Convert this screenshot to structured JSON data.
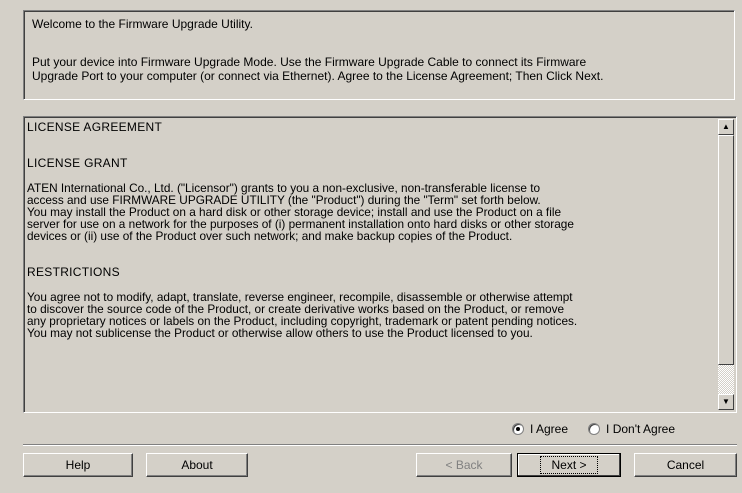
{
  "intro": {
    "welcome": "Welcome to the Firmware Upgrade Utility.",
    "instructions_line1": "Put your device into Firmware Upgrade Mode. Use the Firmware Upgrade Cable to connect its Firmware",
    "instructions_line2": "Upgrade Port to your computer (or connect via Ethernet). Agree to the License Agreement; Then Click Next."
  },
  "license": {
    "title": "LICENSE AGREEMENT",
    "grant_heading": "LICENSE GRANT",
    "grant_lines": [
      "ATEN International Co., Ltd. (\"Licensor\") grants to you a non-exclusive, non-transferable license to",
      "access and use FIRMWARE UPGRADE UTILITY (the \"Product\") during the \"Term\" set forth below.",
      "You may install the Product on a hard disk or other storage device; install and use the Product on a file",
      "server for use on a network for the purposes of (i) permanent installation onto hard disks or other storage",
      "devices or (ii) use of the Product over such network; and make backup copies of the Product."
    ],
    "restrictions_heading": "RESTRICTIONS",
    "restrictions_lines": [
      "You agree not to modify, adapt, translate, reverse engineer, recompile, disassemble or otherwise attempt",
      "to discover the source code of the Product, or create derivative works based on the Product, or remove",
      "any proprietary notices or labels on the Product, including copyright, trademark or patent pending notices.",
      "You may not sublicense the Product or otherwise allow others to use the Product licensed to you."
    ]
  },
  "agreement": {
    "agree_label": "I Agree",
    "disagree_label": "I Don't Agree",
    "selected": "agree"
  },
  "buttons": {
    "help": "Help",
    "about": "About",
    "back": "< Back",
    "next": "Next >",
    "cancel": "Cancel"
  }
}
